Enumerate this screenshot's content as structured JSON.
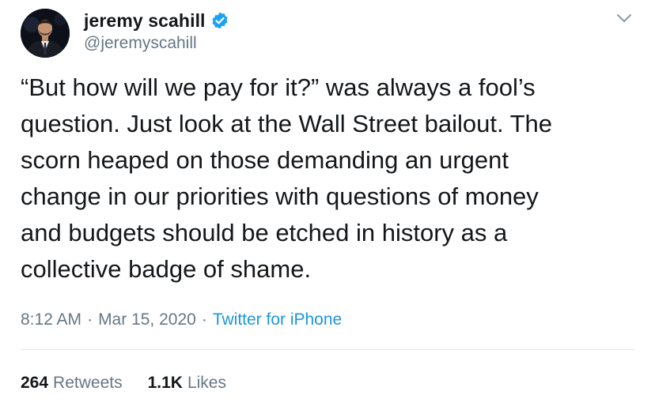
{
  "author": {
    "display_name": "jeremy scahill",
    "handle": "@jeremyscahill",
    "verified": true,
    "avatar_icon": "profile-photo",
    "verified_icon": "verified-badge-icon"
  },
  "menu_icon": "chevron-down-icon",
  "tweet": {
    "text": "“But how will we pay for it?” was always a fool’s\nquestion. Just look at the Wall Street bailout. The\nscorn heaped on those demanding an urgent\nchange in our priorities with questions of money\nand budgets should be etched in history as a\ncollective badge of shame."
  },
  "meta": {
    "time": "8:12 AM",
    "separator1": "·",
    "date": "Mar 15, 2020",
    "separator2": "·",
    "source": "Twitter for iPhone"
  },
  "stats": {
    "retweets_count": "264",
    "retweets_label": "Retweets",
    "likes_count": "1.1K",
    "likes_label": "Likes"
  },
  "colors": {
    "text_primary": "#14171a",
    "text_secondary": "#657786",
    "accent": "#1b95e0",
    "verified": "#1da1f2",
    "divider": "#e1e8ed"
  }
}
